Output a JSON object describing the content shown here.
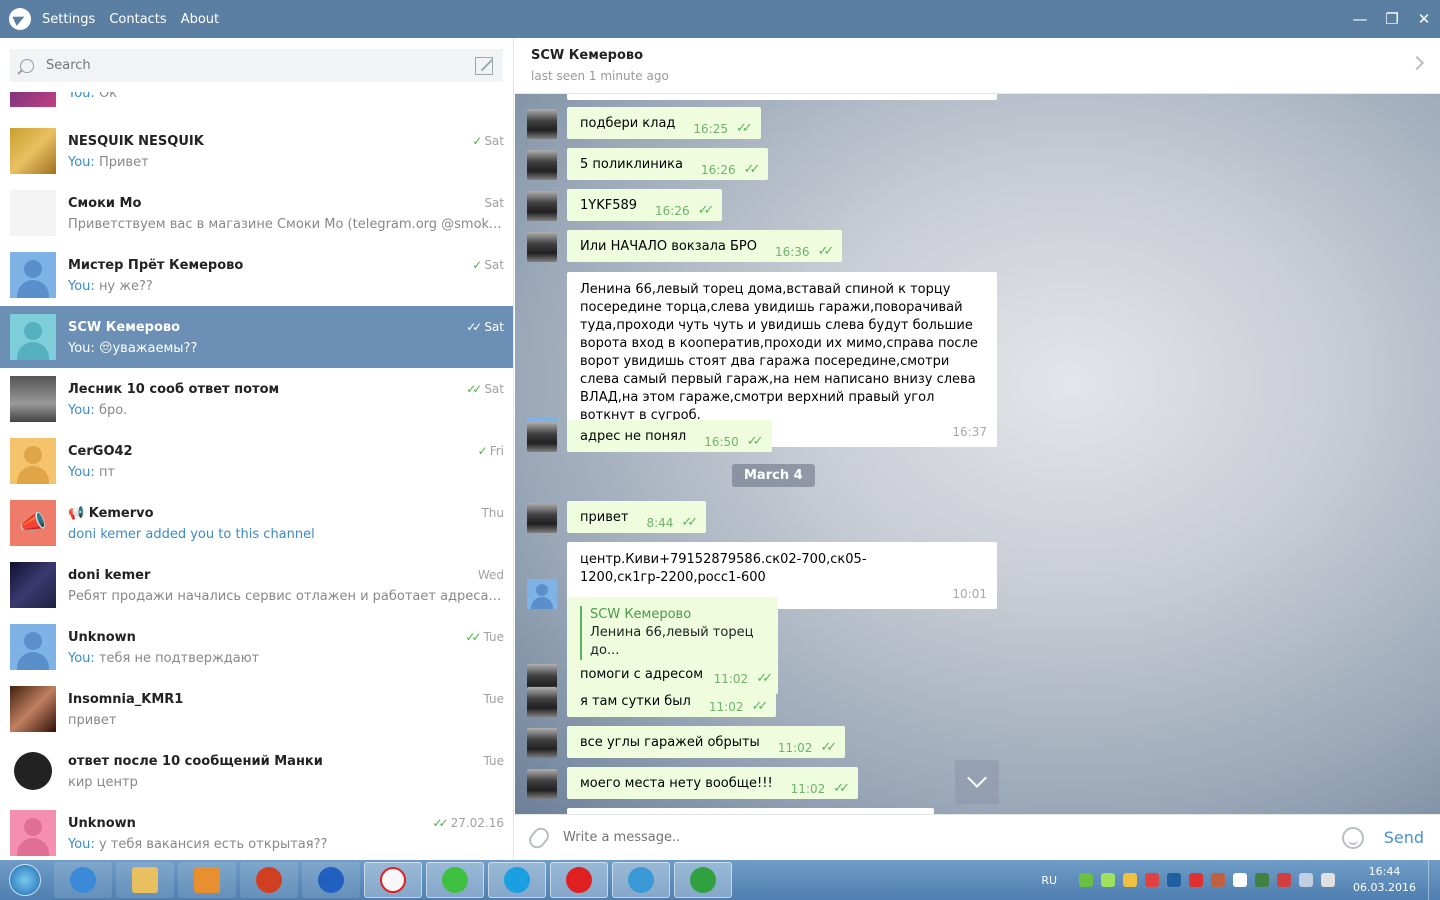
{
  "titlebar": {
    "menu": [
      "Settings",
      "Contacts",
      "About"
    ]
  },
  "search": {
    "placeholder": "Search"
  },
  "top_partial": {
    "you": "You:",
    "text": "Ок"
  },
  "dialogs": [
    {
      "name": "NESQUIK NESQUIK",
      "date": "Sat",
      "check": true,
      "you": "You:",
      "text": "Привет"
    },
    {
      "name": "Смоки Мо",
      "date": "Sat",
      "check": false,
      "you": "",
      "text": "Приветствуем вас в магазине Смоки Мо (telegram.org  @smoke_mo4..."
    },
    {
      "name": "Мистер Прёт Кемерово",
      "date": "Sat",
      "check": true,
      "you": "You:",
      "text": "ну же??"
    },
    {
      "name": "SCW Кемерово",
      "date": "Sat",
      "check": true,
      "you": "You:",
      "text": "😔уважаемы??"
    },
    {
      "name": "Лесник 10 сооб ответ потом",
      "date": "Sat",
      "check": true,
      "you": "You:",
      "text": "бро."
    },
    {
      "name": "CerGO42",
      "date": "Fri",
      "check": true,
      "you": "You:",
      "text": "пт"
    },
    {
      "name": "Kemervo",
      "date": "Thu",
      "check": false,
      "you": "",
      "text": "doni kemer added you to this channel"
    },
    {
      "name": "doni kemer",
      "date": "Wed",
      "check": false,
      "you": "",
      "text": "Ребят продажи начались сервис отлажен и работает адреса свежие ..."
    },
    {
      "name": "Unknown",
      "date": "Tue",
      "check": true,
      "you": "You:",
      "text": "тебя не подтверждают"
    },
    {
      "name": "Insomnia_KMR1",
      "date": "Tue",
      "check": false,
      "you": "",
      "text": "привет"
    },
    {
      "name": "ответ после 10 сообщений Манки",
      "date": "Tue",
      "check": false,
      "you": "",
      "text": "кир центр"
    },
    {
      "name": "Unknown",
      "date": "27.02.16",
      "check": true,
      "you": "You:",
      "text": "у тебя вакансия есть открытая??"
    }
  ],
  "chat": {
    "title": "SCW Кемерово",
    "status": "last seen 1 minute ago",
    "date_separator": "March 4",
    "messages": [
      {
        "text": "подбери клад",
        "time": "16:25"
      },
      {
        "text": "5 поликлиника",
        "time": "16:26"
      },
      {
        "text": "1YKF589",
        "time": "16:26"
      },
      {
        "text": "Или НАЧАЛО вокзала БРО",
        "time": "16:36"
      },
      {
        "text": "Ленина 66,левый торец дома,вставай спиной к торцу посередине торца,слева увидишь гаражи,поворачивай туда,проходи чуть чуть и увидишь слева будут большие ворота вход в кооператив,проходи их мимо,справа после ворот увидишь стоят два гаража посередине,смотри слева самый первый гараж,на нем написано  внизу слева ВЛАД,на этом гараже,смотри верхний правый угол воткнут в сугроб.",
        "time": "16:37"
      },
      {
        "text": "адрес не понял",
        "time": "16:50"
      },
      {
        "text": "привет",
        "time": "8:44"
      },
      {
        "text": "центр.Киви+79152879586.ск02-700,ск05-1200,ск1гр-2200,росс1-600",
        "time": "10:01"
      },
      {
        "reply_name": "SCW Кемерово",
        "reply_text": "Ленина 66,левый торец до...",
        "text": "помоги с адресом",
        "time": "11:02"
      },
      {
        "text": "я там сутки был",
        "time": "11:02"
      },
      {
        "text": "все углы гаражей обрыты",
        "time": "11:02"
      },
      {
        "text": "моего места нету вообще!!!",
        "time": "11:02"
      }
    ]
  },
  "composer": {
    "placeholder": "Write a message..",
    "send": "Send"
  },
  "taskbar": {
    "lang": "RU",
    "time": "16:44",
    "date": "06.03.2016"
  }
}
